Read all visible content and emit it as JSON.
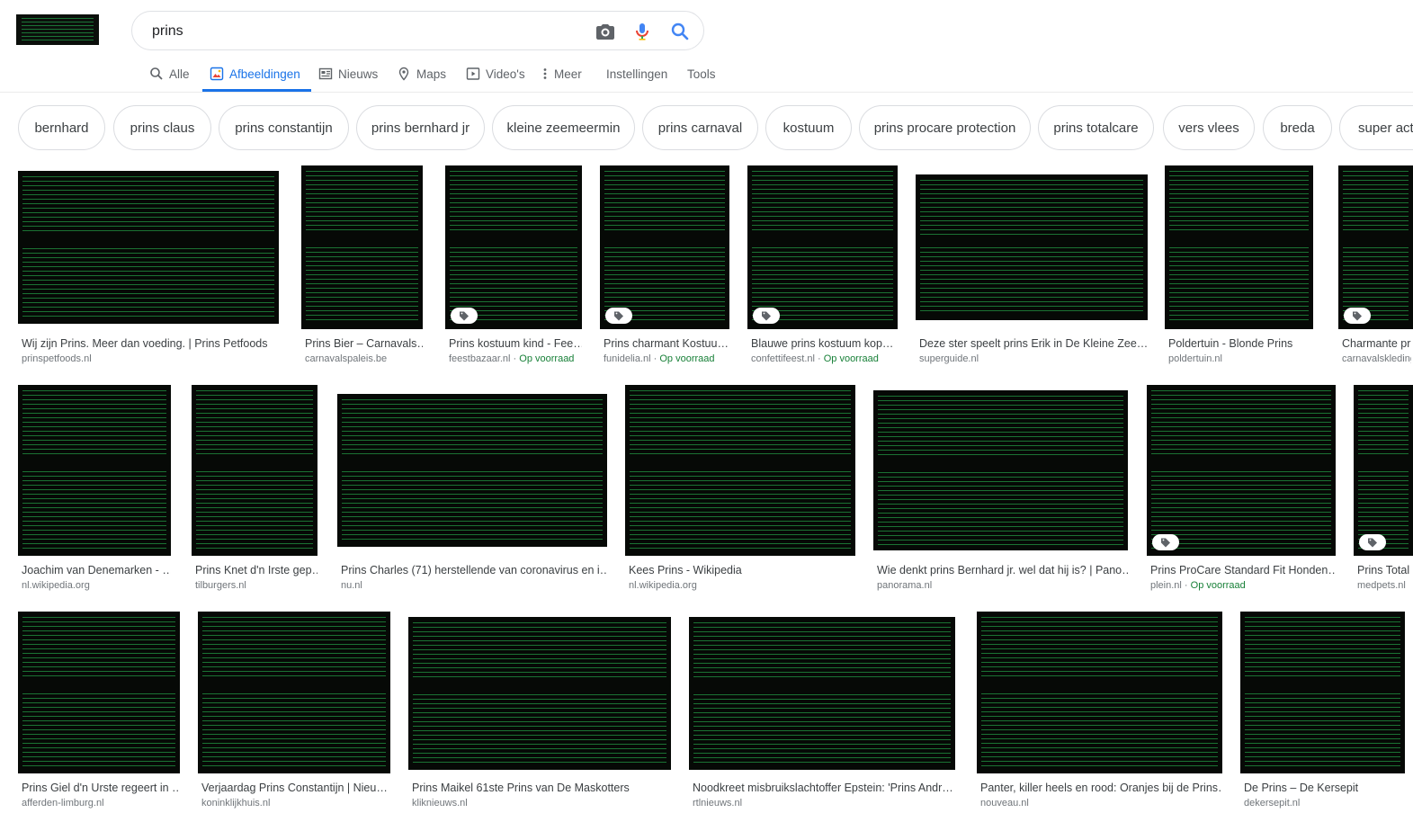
{
  "search": {
    "query": "prins"
  },
  "colors": {
    "accent": "#1a73e8",
    "stock": "#188038",
    "chip_border": "#dadce0",
    "thumb_bg": "#060906",
    "code_green": "#2cc858"
  },
  "icons": {
    "camera": "camera-icon",
    "mic": "mic-icon",
    "search": "search-icon"
  },
  "tabs": [
    {
      "label": "Alle",
      "icon": "search-icon"
    },
    {
      "label": "Afbeeldingen",
      "icon": "image-icon"
    },
    {
      "label": "Nieuws",
      "icon": "news-icon"
    },
    {
      "label": "Maps",
      "icon": "map-pin-icon"
    },
    {
      "label": "Video's",
      "icon": "play-icon"
    },
    {
      "label": "Meer",
      "icon": "more-vert-icon"
    },
    {
      "label": "Instellingen"
    },
    {
      "label": "Tools"
    }
  ],
  "chips": [
    "bernhard",
    "prins claus",
    "prins constantijn",
    "prins bernhard jr",
    "kleine zeemeermin",
    "prins carnaval",
    "kostuum",
    "prins procare protection",
    "prins totalcare",
    "vers vlees",
    "breda",
    "super act"
  ],
  "results": [
    {
      "title": "Wij zijn Prins. Meer dan voeding. | Prins Petfoods",
      "domain": "prinspetfoods.nl",
      "stock": ""
    },
    {
      "title": "Prins Bier – Carnavals…",
      "domain": "carnavalspaleis.be",
      "stock": ""
    },
    {
      "title": "Prins kostuum kind - Fee…",
      "domain": "feestbazaar.nl",
      "stock": "Op voorraad"
    },
    {
      "title": "Prins charmant Kostuu…",
      "domain": "funidelia.nl",
      "stock": "Op voorraad"
    },
    {
      "title": "Blauwe prins kostuum kop…",
      "domain": "confettifeest.nl",
      "stock": "Op voorraad"
    },
    {
      "title": "Deze ster speelt prins Erik in De Kleine Zee…",
      "domain": "superguide.nl",
      "stock": ""
    },
    {
      "title": "Poldertuin - Blonde Prins",
      "domain": "poldertuin.nl",
      "stock": ""
    },
    {
      "title": "Charmante prin",
      "domain": "carnavalskleding",
      "stock": ""
    },
    {
      "title": "Joachim van Denemarken - …",
      "domain": "nl.wikipedia.org",
      "stock": ""
    },
    {
      "title": "Prins Knet d'n Irste gep…",
      "domain": "tilburgers.nl",
      "stock": ""
    },
    {
      "title": "Prins Charles (71) herstellende van coronavirus en i…",
      "domain": "nu.nl",
      "stock": ""
    },
    {
      "title": "Kees Prins - Wikipedia",
      "domain": "nl.wikipedia.org",
      "stock": ""
    },
    {
      "title": "Wie denkt prins Bernhard jr. wel dat hij is? | Pano…",
      "domain": "panorama.nl",
      "stock": ""
    },
    {
      "title": "Prins ProCare Standard Fit Honden…",
      "domain": "plein.nl",
      "stock": "Op voorraad"
    },
    {
      "title": "Prins Total",
      "domain": "medpets.nl",
      "stock": ""
    },
    {
      "title": "Prins Giel d'n Urste regeert in …",
      "domain": "afferden-limburg.nl",
      "stock": ""
    },
    {
      "title": "Verjaardag Prins Constantijn | Nieu…",
      "domain": "koninklijkhuis.nl",
      "stock": ""
    },
    {
      "title": "Prins Maikel 61ste Prins van De Maskotters",
      "domain": "kliknieuws.nl",
      "stock": ""
    },
    {
      "title": "Noodkreet misbruikslachtoffer Epstein: 'Prins Andr…",
      "domain": "rtlnieuws.nl",
      "stock": ""
    },
    {
      "title": "Panter, killer heels en rood: Oranjes bij de Prins…",
      "domain": "nouveau.nl",
      "stock": ""
    },
    {
      "title": "De Prins – De Kersepit",
      "domain": "dekersepit.nl",
      "stock": ""
    }
  ]
}
